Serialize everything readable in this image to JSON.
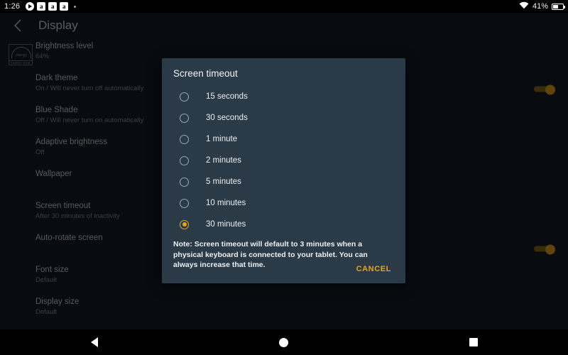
{
  "status_bar": {
    "time": "1:26",
    "left_icons": [
      "play-circle-icon",
      "amazon-app-icon",
      "amazon-app-icon",
      "amazon-app-icon",
      "more-dot-icon"
    ],
    "app_icon_letter": "a",
    "wifi_icon": "wifi-icon",
    "battery_percent": "41%",
    "battery_icon": "battery-icon"
  },
  "app_bar": {
    "back_icon": "back-chevron-icon",
    "title": "Display"
  },
  "settings": {
    "items": [
      {
        "title": "Brightness level",
        "sub": "64%",
        "icon": "energy-star-icon",
        "toggle": null
      },
      {
        "title": "Dark theme",
        "sub": "On / Will never turn off automatically",
        "icon": null,
        "toggle": "on"
      },
      {
        "title": "Blue Shade",
        "sub": "Off / Will never turn on automatically",
        "icon": null,
        "toggle": null
      },
      {
        "title": "Adaptive brightness",
        "sub": "Off",
        "icon": null,
        "toggle": null
      },
      {
        "title": "Wallpaper",
        "sub": "",
        "icon": null,
        "toggle": null
      },
      {
        "title": "Screen timeout",
        "sub": "After 30 minutes of inactivity",
        "icon": null,
        "toggle": null
      },
      {
        "title": "Auto-rotate screen",
        "sub": "",
        "icon": null,
        "toggle": "on"
      },
      {
        "title": "Font size",
        "sub": "Default",
        "icon": null,
        "toggle": null
      },
      {
        "title": "Display size",
        "sub": "Default",
        "icon": null,
        "toggle": null
      }
    ],
    "energy_star_label": "ENERGY STAR"
  },
  "dialog": {
    "title": "Screen timeout",
    "options": [
      {
        "label": "15 seconds",
        "selected": false
      },
      {
        "label": "30 seconds",
        "selected": false
      },
      {
        "label": "1 minute",
        "selected": false
      },
      {
        "label": "2 minutes",
        "selected": false
      },
      {
        "label": "5 minutes",
        "selected": false
      },
      {
        "label": "10 minutes",
        "selected": false
      },
      {
        "label": "30 minutes",
        "selected": true
      }
    ],
    "note": "Note: Screen timeout will default to 3 minutes when a physical keyboard is connected to your tablet. You can always increase that time.",
    "cancel_label": "CANCEL"
  },
  "nav_bar": {
    "back": "back-triangle-icon",
    "home": "home-circle-icon",
    "recents": "recents-square-icon"
  },
  "colors": {
    "accent": "#e8a317",
    "dialog_bg": "#2b3a47",
    "page_bg": "#141c25",
    "status_bg": "#000000"
  }
}
